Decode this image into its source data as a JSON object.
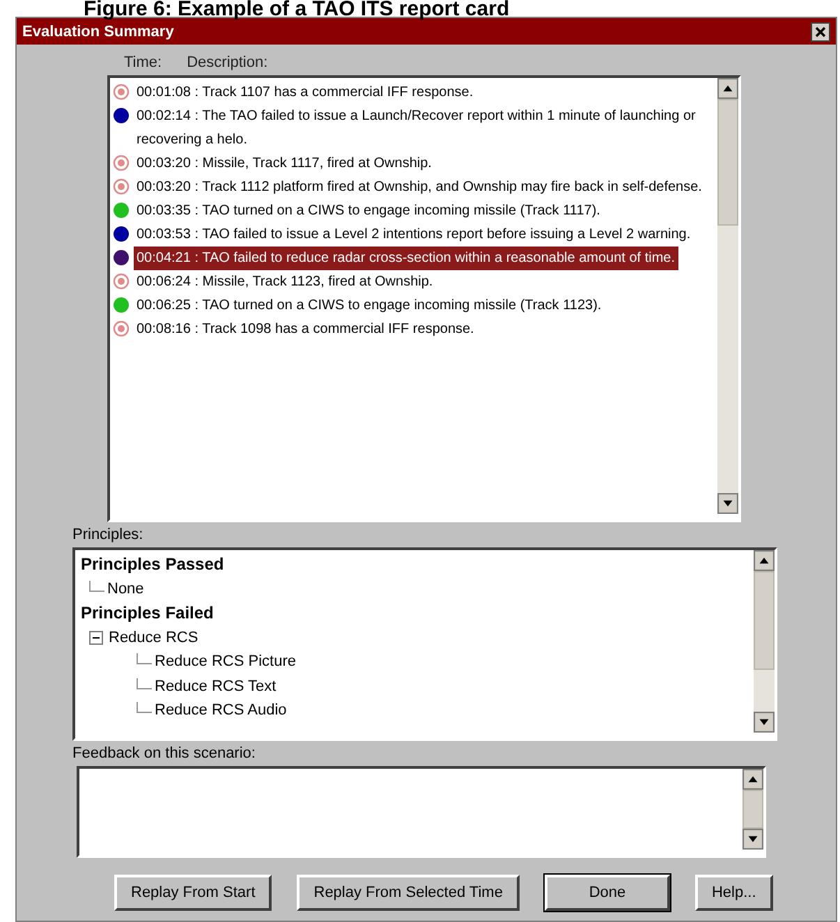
{
  "caption": "Figure 6: Example of a TAO ITS report card",
  "window": {
    "title": "Evaluation Summary"
  },
  "columns": [
    "Time:",
    "Description:"
  ],
  "events": [
    {
      "kind": "badge",
      "color": "#e08a8a",
      "text": "00:01:08 : Track 1107 has a commercial IFF response.",
      "selected": false
    },
    {
      "kind": "dot",
      "color": "#0000a0",
      "text": "00:02:14 : The TAO failed to issue a Launch/Recover report within 1 minute of launching or recovering a helo.",
      "selected": false
    },
    {
      "kind": "badge",
      "color": "#e08a8a",
      "text": "00:03:20 : Missile, Track 1117, fired at Ownship.",
      "selected": false
    },
    {
      "kind": "badge",
      "color": "#e08a8a",
      "text": "00:03:20 : Track 1112 platform fired at Ownship, and Ownship may fire back in self-defense.",
      "selected": false
    },
    {
      "kind": "dot",
      "color": "#20c020",
      "text": "00:03:35 : TAO turned on a CIWS to engage incoming missile (Track 1117).",
      "selected": false
    },
    {
      "kind": "dot",
      "color": "#0000a0",
      "text": "00:03:53 : TAO failed to issue a Level 2 intentions report before issuing a Level 2 warning.",
      "selected": false
    },
    {
      "kind": "dot",
      "color": "#40106a",
      "text": "00:04:21 : TAO failed to reduce radar cross-section within a reasonable amount of time.",
      "selected": true
    },
    {
      "kind": "badge",
      "color": "#e08a8a",
      "text": "00:06:24 : Missile, Track 1123, fired at Ownship.",
      "selected": false
    },
    {
      "kind": "dot",
      "color": "#20c020",
      "text": "00:06:25 : TAO turned on a CIWS to engage incoming missile (Track 1123).",
      "selected": false
    },
    {
      "kind": "badge",
      "color": "#e08a8a",
      "text": "00:08:16 : Track 1098 has a commercial IFF response.",
      "selected": false
    }
  ],
  "principles_label": "Principles:",
  "principles": [
    {
      "label": "Principles Passed",
      "children": [
        {
          "label": "None"
        }
      ]
    },
    {
      "label": "Principles Failed",
      "children": [
        {
          "label": "Reduce RCS",
          "expanded": true,
          "children": [
            {
              "label": "Reduce RCS Picture"
            },
            {
              "label": "Reduce RCS Text"
            },
            {
              "label": "Reduce RCS Audio"
            }
          ]
        }
      ]
    }
  ],
  "feedback_label": "Feedback on this scenario:",
  "buttons": [
    {
      "label": "Replay From Start",
      "default": false
    },
    {
      "label": "Replay From Selected Time",
      "default": false
    },
    {
      "label": "Done",
      "default": true
    },
    {
      "label": "Help...",
      "default": false
    }
  ]
}
